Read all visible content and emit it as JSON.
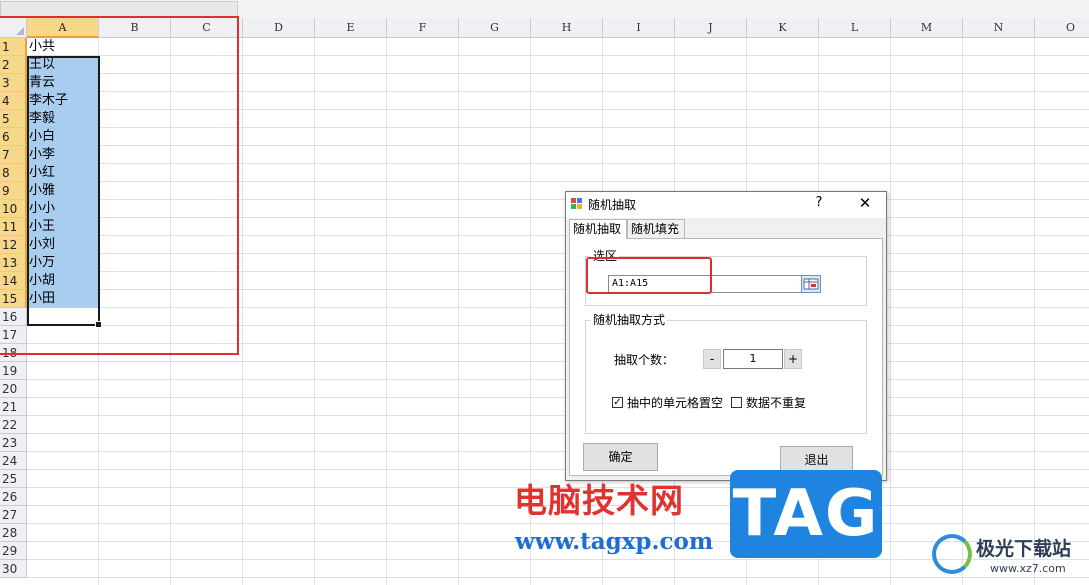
{
  "sheet": {
    "columns": [
      "A",
      "B",
      "C",
      "D",
      "E",
      "F",
      "G",
      "H",
      "I",
      "J",
      "K",
      "L",
      "M",
      "N",
      "O"
    ],
    "selected_column": "A",
    "rows": [
      "1",
      "2",
      "3",
      "4",
      "5",
      "6",
      "7",
      "8",
      "9",
      "10",
      "11",
      "12",
      "13",
      "14",
      "15",
      "16",
      "17",
      "18",
      "19",
      "20",
      "21",
      "22",
      "23",
      "24",
      "25",
      "26",
      "27",
      "28",
      "29",
      "30"
    ],
    "selected_rows": [
      1,
      15
    ],
    "column_a": [
      "小共",
      "王以",
      "青云",
      "李木子",
      "李毅",
      "小白",
      "小李",
      "小红",
      "小雅",
      "小小",
      "小王",
      "小刘",
      "小万",
      "小胡",
      "小田"
    ]
  },
  "dialog": {
    "title": "随机抽取",
    "help": "?",
    "close": "✕",
    "tabs": [
      "随机抽取",
      "随机填充"
    ],
    "active_tab": 0,
    "selection_group": {
      "legend": "选区",
      "range_value": "A1:A15"
    },
    "method_group": {
      "legend": "随机抽取方式",
      "count_label": "抽取个数：",
      "minus": "-",
      "count_value": "1",
      "plus": "+",
      "option1": {
        "label": "抽中的单元格置空",
        "checked": true
      },
      "option2": {
        "label": "数据不重复",
        "checked": false
      }
    },
    "ok_label": "确定",
    "exit_label": "退出"
  },
  "watermark": {
    "site_cn": "电脑技术网",
    "site_url": "www.tagxp.com",
    "tag": "TAG",
    "logo_name": "极光下载站",
    "logo_url": "www.xz7.com"
  },
  "colors": {
    "selection_fill": "#a9cdee",
    "header_selected": "#f7d78a",
    "highlight_red": "#e02d2d"
  }
}
